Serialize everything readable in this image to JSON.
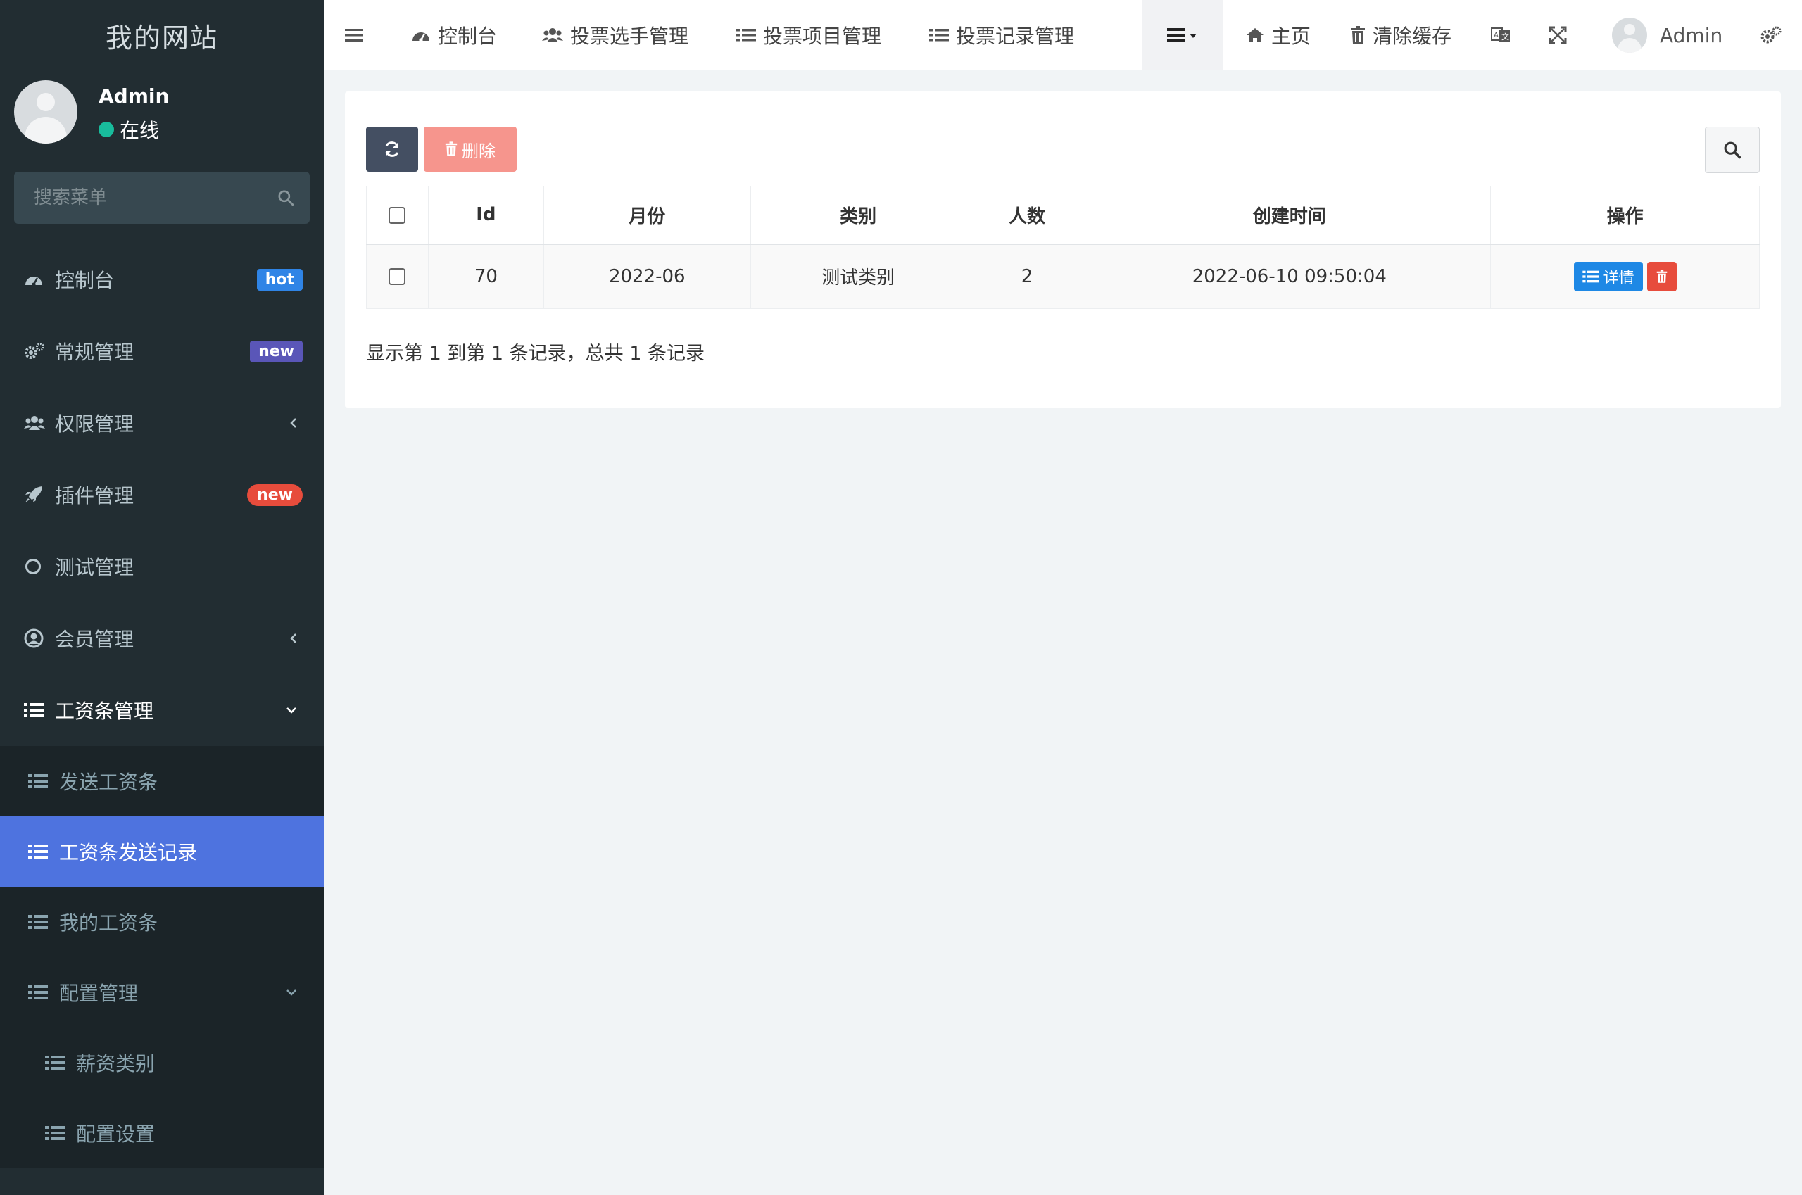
{
  "sidebar": {
    "brand": "我的网站",
    "user": {
      "name": "Admin",
      "status": "在线"
    },
    "search_placeholder": "搜索菜单",
    "menu": [
      {
        "label": "控制台",
        "icon": "dashboard-icon",
        "badge": "hot"
      },
      {
        "label": "常规管理",
        "icon": "cogs-icon",
        "badge": "new"
      },
      {
        "label": "权限管理",
        "icon": "users-icon"
      },
      {
        "label": "插件管理",
        "icon": "rocket-icon",
        "badge": "new"
      },
      {
        "label": "测试管理",
        "icon": "circle-icon"
      },
      {
        "label": "会员管理",
        "icon": "user-circle-icon"
      },
      {
        "label": "工资条管理",
        "icon": "list-icon"
      }
    ],
    "submenu": [
      {
        "label": "发送工资条"
      },
      {
        "label": "工资条发送记录"
      },
      {
        "label": "我的工资条"
      },
      {
        "label": "配置管理"
      }
    ],
    "subsubmenu": [
      {
        "label": "薪资类别"
      },
      {
        "label": "配置设置"
      }
    ]
  },
  "topbar": {
    "tabs": [
      {
        "label": "控制台",
        "icon": "dashboard-icon"
      },
      {
        "label": "投票选手管理",
        "icon": "users-icon"
      },
      {
        "label": "投票项目管理",
        "icon": "list-icon"
      },
      {
        "label": "投票记录管理",
        "icon": "list-icon"
      }
    ],
    "home_label": "主页",
    "clear_cache_label": "清除缓存",
    "user_name": "Admin"
  },
  "toolbar": {
    "delete_label": "删除"
  },
  "table": {
    "headers": [
      "Id",
      "月份",
      "类别",
      "人数",
      "创建时间",
      "操作"
    ],
    "rows": [
      {
        "id": "70",
        "month": "2022-06",
        "category": "测试类别",
        "count": "2",
        "created": "2022-06-10 09:50:04"
      }
    ],
    "detail_label": "详情"
  },
  "pagination": {
    "info": "显示第 1 到第 1 条记录，总共 1 条记录"
  },
  "colors": {
    "sidebar_bg": "#222d32",
    "active": "#4e73df",
    "danger": "#e74c3c",
    "primary": "#1e88e5"
  }
}
